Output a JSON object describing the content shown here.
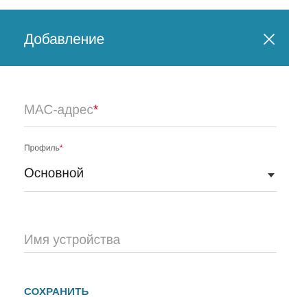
{
  "dialog": {
    "title": "Добавление",
    "close_icon": "close-icon",
    "accent_color": "#1f86a6"
  },
  "form": {
    "mac": {
      "placeholder": "MAC-адрес",
      "required_mark": "*"
    },
    "profile": {
      "label": "Профиль",
      "required_mark": "*",
      "selected": "Основной",
      "dropdown_icon": "caret-down-icon"
    },
    "device_name": {
      "placeholder": "Имя устройства"
    }
  },
  "actions": {
    "save_label": "СОХРАНИТЬ"
  }
}
